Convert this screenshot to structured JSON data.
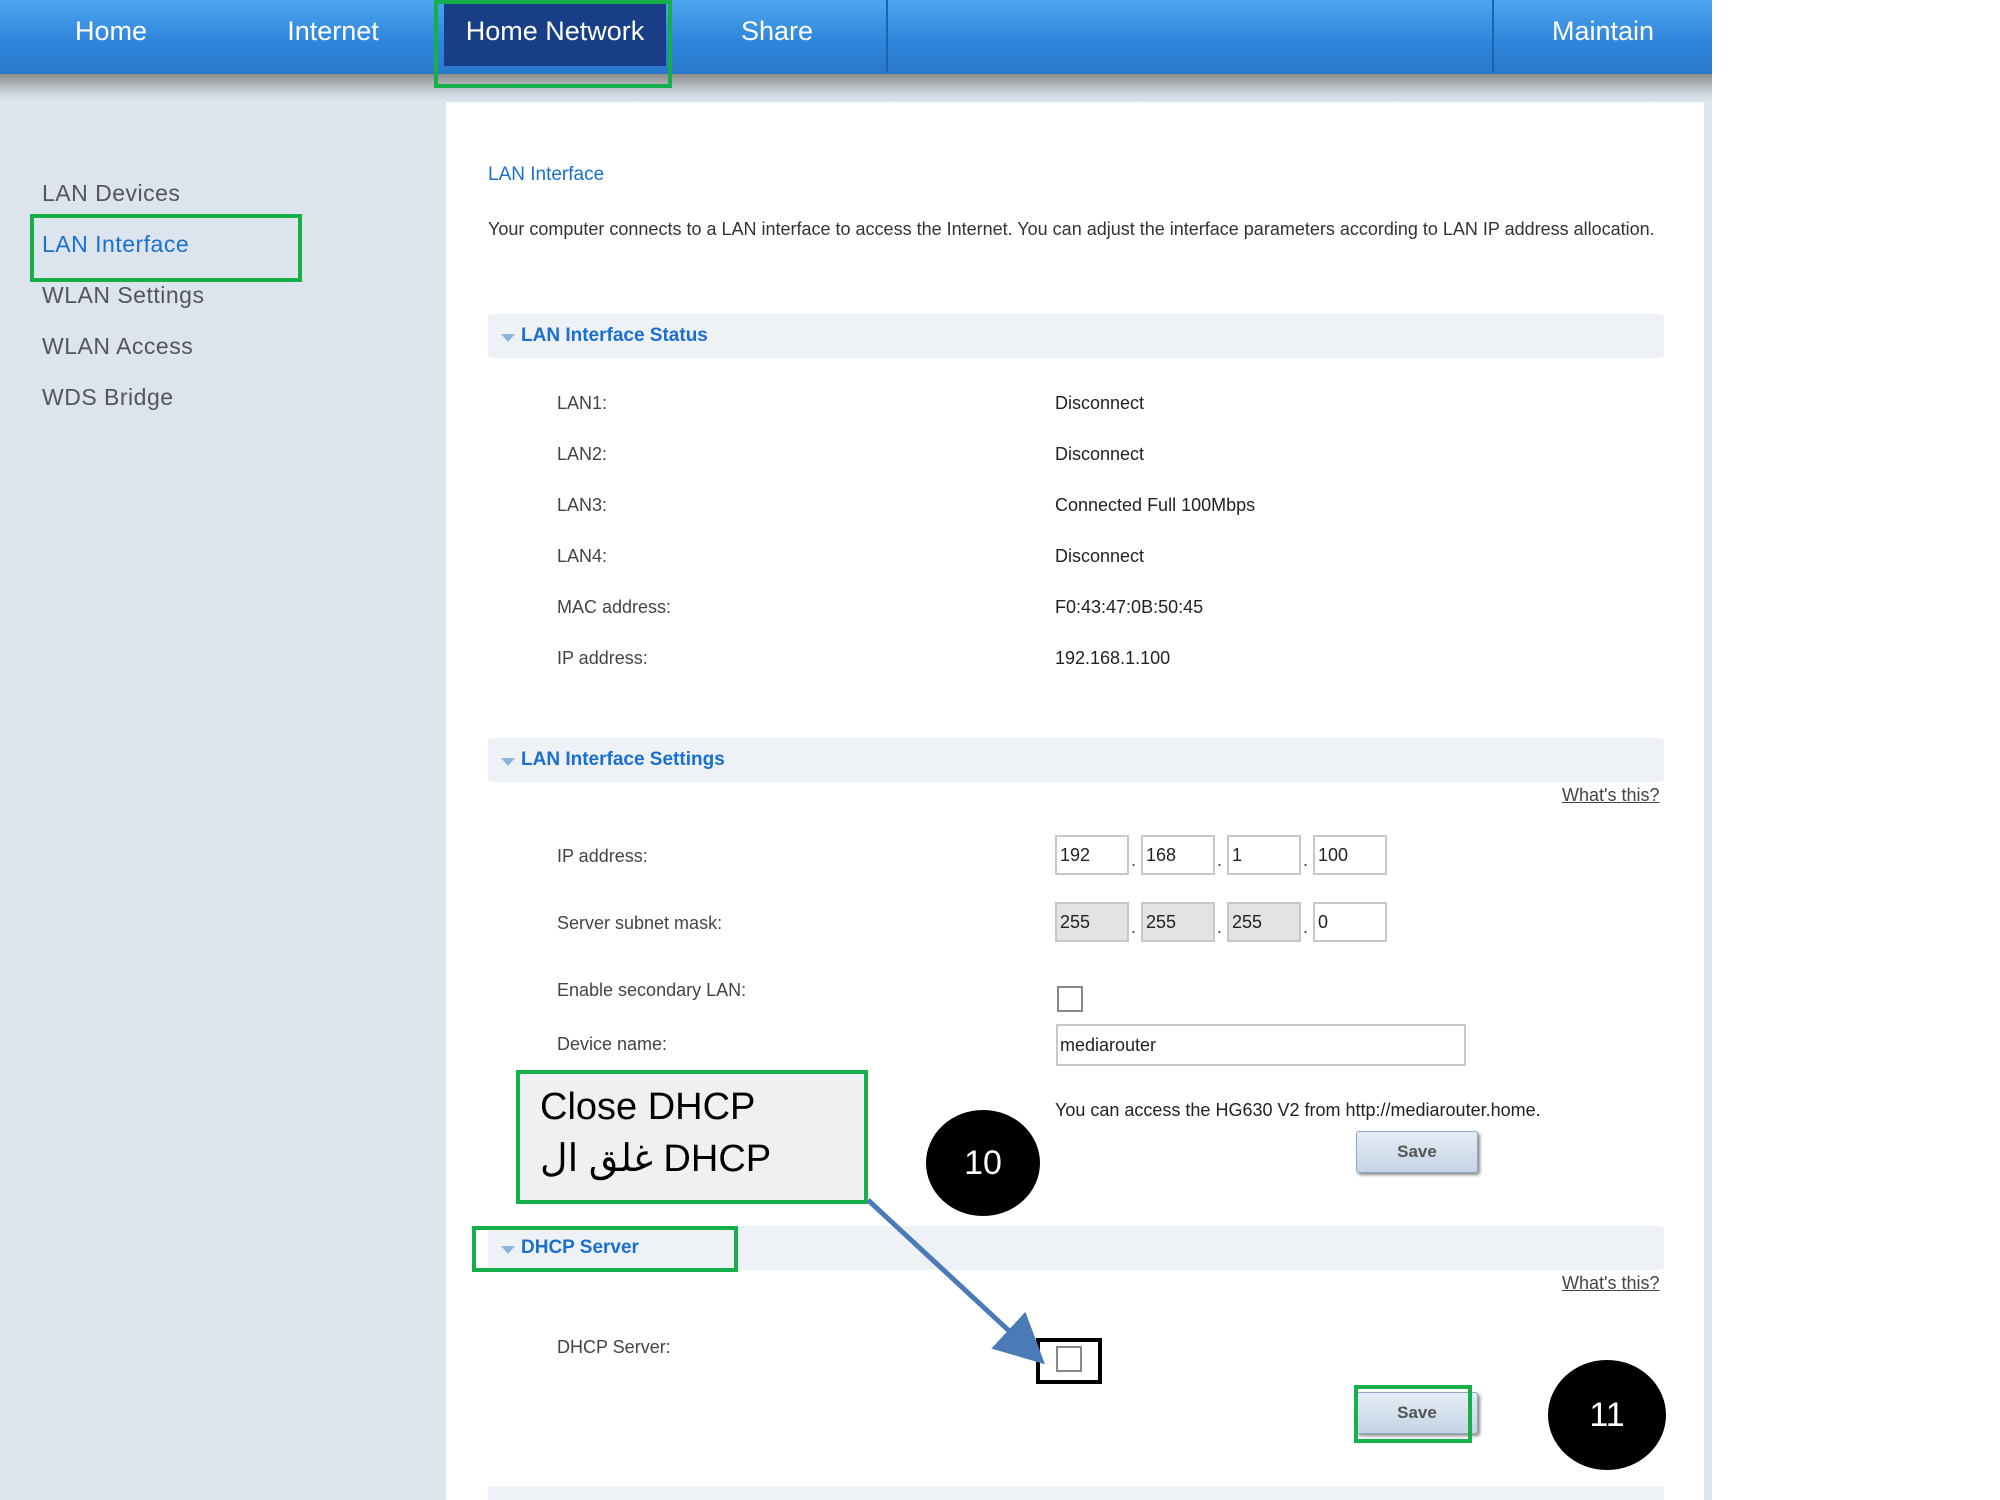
{
  "top_nav": {
    "items": [
      {
        "label": "Home"
      },
      {
        "label": "Internet"
      },
      {
        "label": "Home Network"
      },
      {
        "label": "Share"
      },
      {
        "label": "Maintain"
      }
    ],
    "active": "Home Network"
  },
  "sidebar": {
    "items": [
      {
        "label": "LAN Devices"
      },
      {
        "label": "LAN Interface"
      },
      {
        "label": "WLAN Settings"
      },
      {
        "label": "WLAN Access"
      },
      {
        "label": "WDS Bridge"
      }
    ],
    "active": "LAN Interface"
  },
  "page": {
    "title": "LAN Interface",
    "intro": "Your computer connects to a LAN interface to access the Internet. You can adjust the interface parameters according to LAN IP address allocation."
  },
  "status_section": {
    "title": "LAN Interface Status",
    "rows": [
      {
        "label": "LAN1:",
        "value": "Disconnect"
      },
      {
        "label": "LAN2:",
        "value": "Disconnect"
      },
      {
        "label": "LAN3:",
        "value": "Connected Full 100Mbps"
      },
      {
        "label": "LAN4:",
        "value": "Disconnect"
      },
      {
        "label": "MAC address:",
        "value": "F0:43:47:0B:50:45"
      },
      {
        "label": "IP address:",
        "value": "192.168.1.100"
      }
    ]
  },
  "settings_section": {
    "title": "LAN Interface Settings",
    "whats_this": "What's this?",
    "ip_label": "IP address:",
    "ip": [
      "192",
      "168",
      "1",
      "100"
    ],
    "mask_label": "Server subnet mask:",
    "mask": [
      "255",
      "255",
      "255",
      "0"
    ],
    "secondary_label": "Enable secondary LAN:",
    "secondary_checked": false,
    "device_label": "Device name:",
    "device_value": "mediarouter",
    "access_note": "You can access the HG630 V2 from http://mediarouter.home.",
    "save_label": "Save"
  },
  "dhcp_section": {
    "title": "DHCP Server",
    "whats_this": "What's this?",
    "label": "DHCP Server:",
    "checked": false,
    "save_label": "Save"
  },
  "annotations": {
    "callout_line1": "Close DHCP",
    "callout_line2": "غلق ال DHCP",
    "step10": "10",
    "step11": "11",
    "highlight_color": "#15b04a",
    "arrow_color": "#4a7ab8"
  }
}
